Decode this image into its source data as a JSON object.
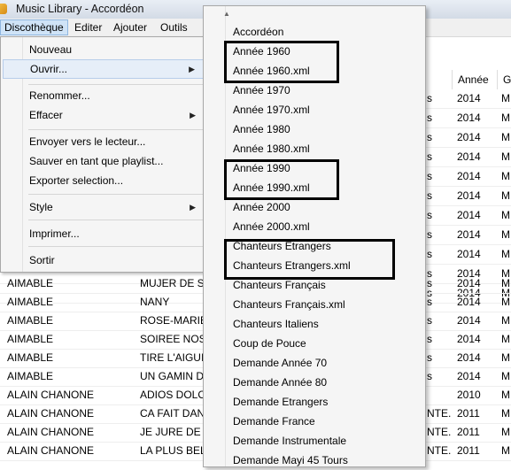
{
  "window": {
    "title": "Music Library - Accordéon"
  },
  "menubar": [
    {
      "label": "Discothèque",
      "active": true
    },
    {
      "label": "Editer"
    },
    {
      "label": "Ajouter"
    },
    {
      "label": "Outils"
    }
  ],
  "file_menu": {
    "items": [
      {
        "label": "Nouveau"
      },
      {
        "label": "Ouvrir..."
      },
      {
        "label": "Renommer..."
      },
      {
        "label": "Effacer"
      },
      {
        "label": "Envoyer vers le lecteur..."
      },
      {
        "label": "Sauver en tant que playlist..."
      },
      {
        "label": "Exporter selection..."
      },
      {
        "label": "Style"
      },
      {
        "label": "Imprimer..."
      },
      {
        "label": "Sortir"
      }
    ]
  },
  "submenu": {
    "items": [
      "Accordéon",
      "Année 1960",
      "Année 1960.xml",
      "Année 1970",
      "Année 1970.xml",
      "Année 1980",
      "Année 1980.xml",
      "Année 1990",
      "Année 1990.xml",
      "Année 2000",
      "Année 2000.xml",
      "Chanteurs Etrangers",
      "Chanteurs Etrangers.xml",
      "Chanteurs Français",
      "Chanteurs Français.xml",
      "Chanteurs Italiens",
      "Coup de Pouce",
      "Demande Année 70",
      "Demande Année 80",
      "Demande Etrangers",
      "Demande France",
      "Demande Instrumentale",
      "Demande Mayi 45 Tours"
    ]
  },
  "table": {
    "headers": {
      "year": "Année",
      "genre": "Ge"
    },
    "upper_rows": [
      {
        "c3": "s",
        "year": "2014",
        "genre": "M"
      },
      {
        "c3": "s",
        "year": "2014",
        "genre": "M"
      },
      {
        "c3": "s",
        "year": "2014",
        "genre": "M"
      },
      {
        "c3": "s",
        "year": "2014",
        "genre": "M"
      },
      {
        "c3": "s",
        "year": "2014",
        "genre": "M"
      },
      {
        "c3": "s",
        "year": "2014",
        "genre": "M"
      },
      {
        "c3": "s",
        "year": "2014",
        "genre": "M"
      },
      {
        "c3": "s",
        "year": "2014",
        "genre": "M"
      },
      {
        "c3": "s",
        "year": "2014",
        "genre": "M"
      },
      {
        "c3": "s",
        "year": "2014",
        "genre": "M"
      },
      {
        "c3": "s",
        "year": "2014",
        "genre": "M"
      }
    ],
    "lower_rows": [
      {
        "artist": "AIMABLE",
        "title": "MUJER DE SEV",
        "c3": "s",
        "year": "2014",
        "genre": "M"
      },
      {
        "artist": "AIMABLE",
        "title": "NANY",
        "c3": "s",
        "year": "2014",
        "genre": "M"
      },
      {
        "artist": "AIMABLE",
        "title": "ROSE-MARIE",
        "c3": "s",
        "year": "2014",
        "genre": "M"
      },
      {
        "artist": "AIMABLE",
        "title": "SOIREE NOST",
        "c3": "s",
        "year": "2014",
        "genre": "M"
      },
      {
        "artist": "AIMABLE",
        "title": "TIRE L'AIGUIL",
        "c3": "s",
        "year": "2014",
        "genre": "M"
      },
      {
        "artist": "AIMABLE",
        "title": "UN GAMIN D",
        "c3": "s",
        "year": "2014",
        "genre": "M"
      },
      {
        "artist": "ALAIN CHANONE",
        "title": "ADIOS DOLO",
        "c3": "",
        "year": "2010",
        "genre": "M"
      },
      {
        "artist": "ALAIN CHANONE",
        "title": "CA FAIT DAN",
        "c3": "NTE...",
        "year": "2011",
        "genre": "M"
      },
      {
        "artist": "ALAIN CHANONE",
        "title": "JE JURE DE N'",
        "c3": "NTE...",
        "year": "2011",
        "genre": "M"
      },
      {
        "artist": "ALAIN CHANONE",
        "title": "LA PLUS BELL",
        "c3": "NTE...",
        "year": "2011",
        "genre": "M"
      }
    ]
  }
}
